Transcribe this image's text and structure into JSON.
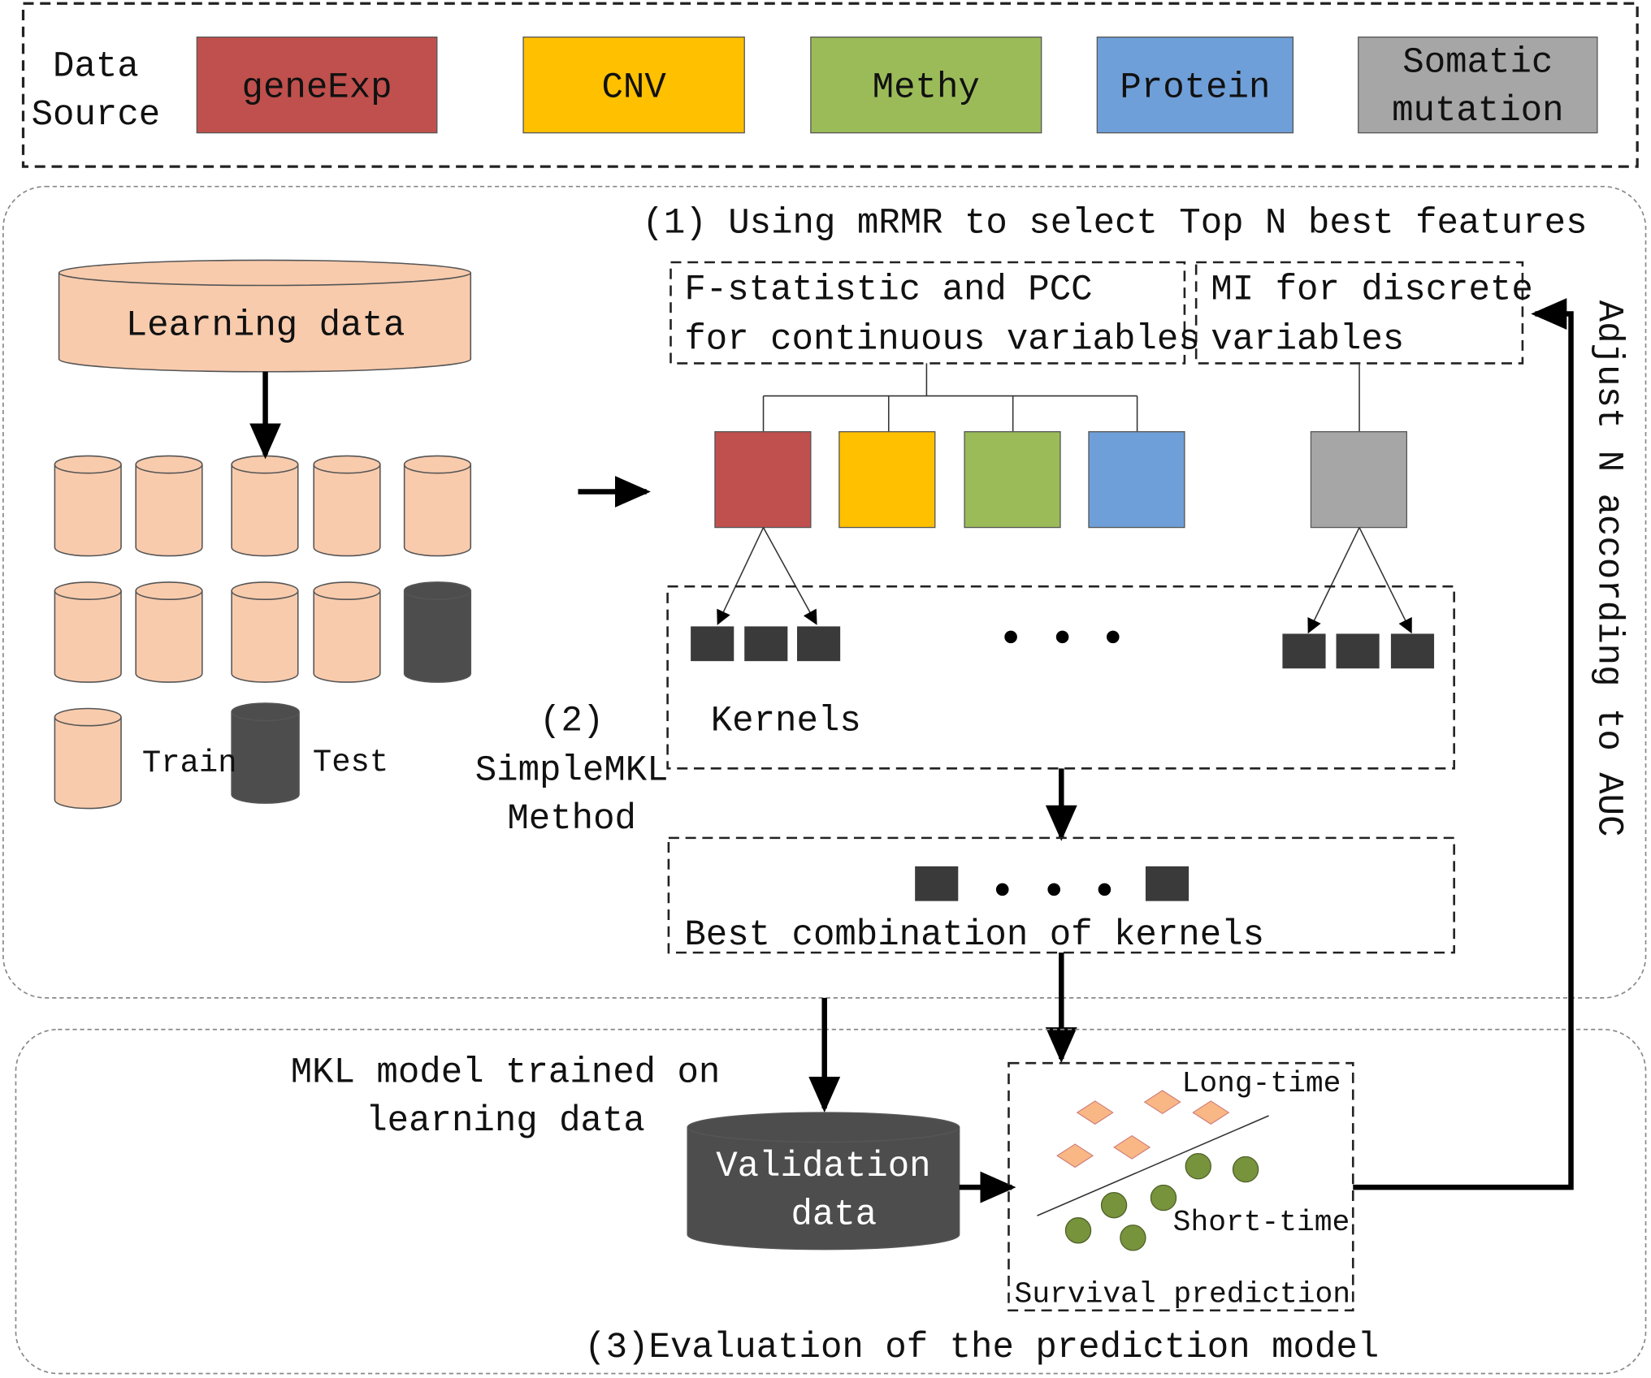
{
  "data_source": {
    "label_lines": [
      "Data",
      "Source"
    ],
    "items": [
      {
        "label": "geneExp",
        "color": "#c0504d"
      },
      {
        "label": "CNV",
        "color": "#ffc000"
      },
      {
        "label": "Methy",
        "color": "#9bbb59"
      },
      {
        "label": "Protein",
        "color": "#6f9fd8"
      },
      {
        "label_lines": [
          "Somatic",
          "mutation"
        ],
        "color": "#a6a6a6"
      }
    ]
  },
  "step1": {
    "title": "(1) Using mRMR to select Top N best features",
    "continuous_lines": [
      "F-statistic and PCC",
      "for continuous variables"
    ],
    "discrete_lines": [
      "MI for discrete",
      "variables"
    ]
  },
  "learning": {
    "label": "Learning data",
    "train_label": "Train",
    "test_label": "Test",
    "colors": {
      "train": "#f8cbad",
      "test": "#4d4d4d"
    }
  },
  "step2": {
    "label_lines": [
      "(2)",
      "SimpleMKL",
      "Method"
    ],
    "kernels_label": "Kernels",
    "best_label": "Best combination of kernels"
  },
  "step3": {
    "mkl_lines": [
      "MKL model trained on",
      "learning data"
    ],
    "validation_lines": [
      "Validation",
      "data"
    ],
    "long_label": "Long-time",
    "short_label": "Short-time",
    "survival_label": "Survival prediction",
    "title": "(3)Evaluation of the prediction model",
    "colors": {
      "long": "#f8b784",
      "short": "#77933c"
    }
  },
  "feedback_label": "Adjust N according to AUC"
}
